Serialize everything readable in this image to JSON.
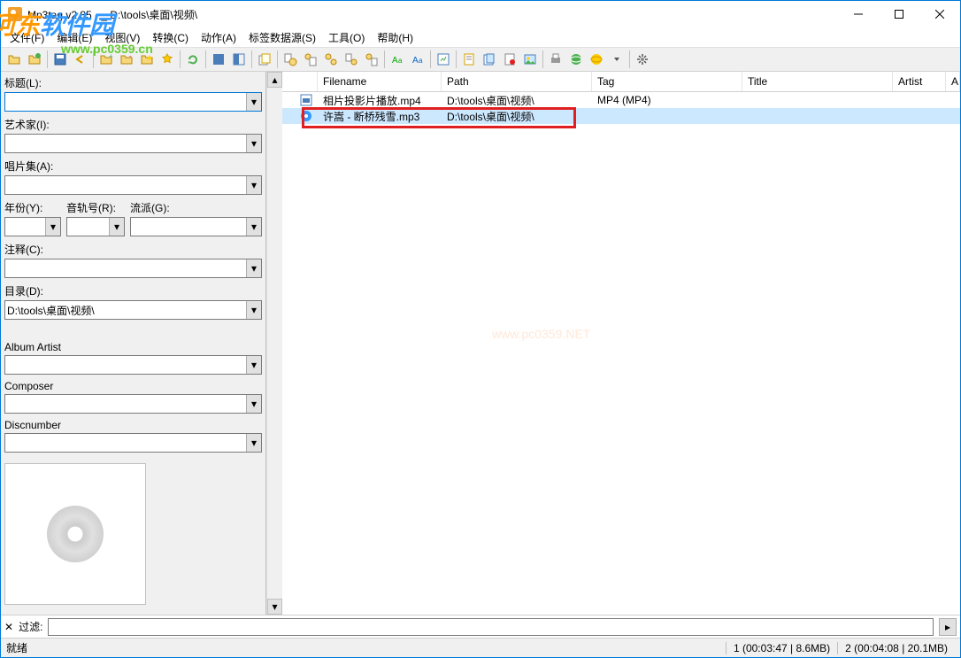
{
  "title": "Mp3tag v2.85 - _ D:\\tools\\桌面\\视频\\",
  "menu": [
    "文件(F)",
    "编辑(E)",
    "视图(V)",
    "转换(C)",
    "动作(A)",
    "标签数据源(S)",
    "工具(O)",
    "帮助(H)"
  ],
  "sidebar": {
    "fields": {
      "title": {
        "label": "标题(L):",
        "value": ""
      },
      "artist": {
        "label": "艺术家(I):",
        "value": ""
      },
      "album": {
        "label": "唱片集(A):",
        "value": ""
      },
      "year": {
        "label": "年份(Y):",
        "value": ""
      },
      "track": {
        "label": "音轨号(R):",
        "value": ""
      },
      "genre": {
        "label": "流派(G):",
        "value": ""
      },
      "comment": {
        "label": "注释(C):",
        "value": ""
      },
      "directory": {
        "label": "目录(D):",
        "value": "D:\\tools\\桌面\\视频\\"
      },
      "albumartist": {
        "label": "Album Artist",
        "value": ""
      },
      "composer": {
        "label": "Composer",
        "value": ""
      },
      "discnumber": {
        "label": "Discnumber",
        "value": ""
      }
    }
  },
  "columns": {
    "filename": "Filename",
    "path": "Path",
    "tag": "Tag",
    "title": "Title",
    "artist": "Artist",
    "a": "A"
  },
  "rows": [
    {
      "filename": "相片投影片播放.mp4",
      "path": "D:\\tools\\桌面\\视频\\",
      "tag": "MP4 (MP4)",
      "title": "",
      "artist": ""
    },
    {
      "filename": "许嵩 - 断桥残雪.mp3",
      "path": "D:\\tools\\桌面\\视频\\",
      "tag": "",
      "title": "",
      "artist": ""
    }
  ],
  "filter": {
    "label": "过滤:",
    "value": ""
  },
  "status": {
    "ready": "就绪",
    "seg1": "1 (00:03:47 | 8.6MB)",
    "seg2": "2 (00:04:08 | 20.1MB)"
  },
  "watermark": {
    "brand1": "河东",
    "brand2": "软件园",
    "url": "www.pc0359.cn",
    "center": "www.pc0359.NET"
  }
}
